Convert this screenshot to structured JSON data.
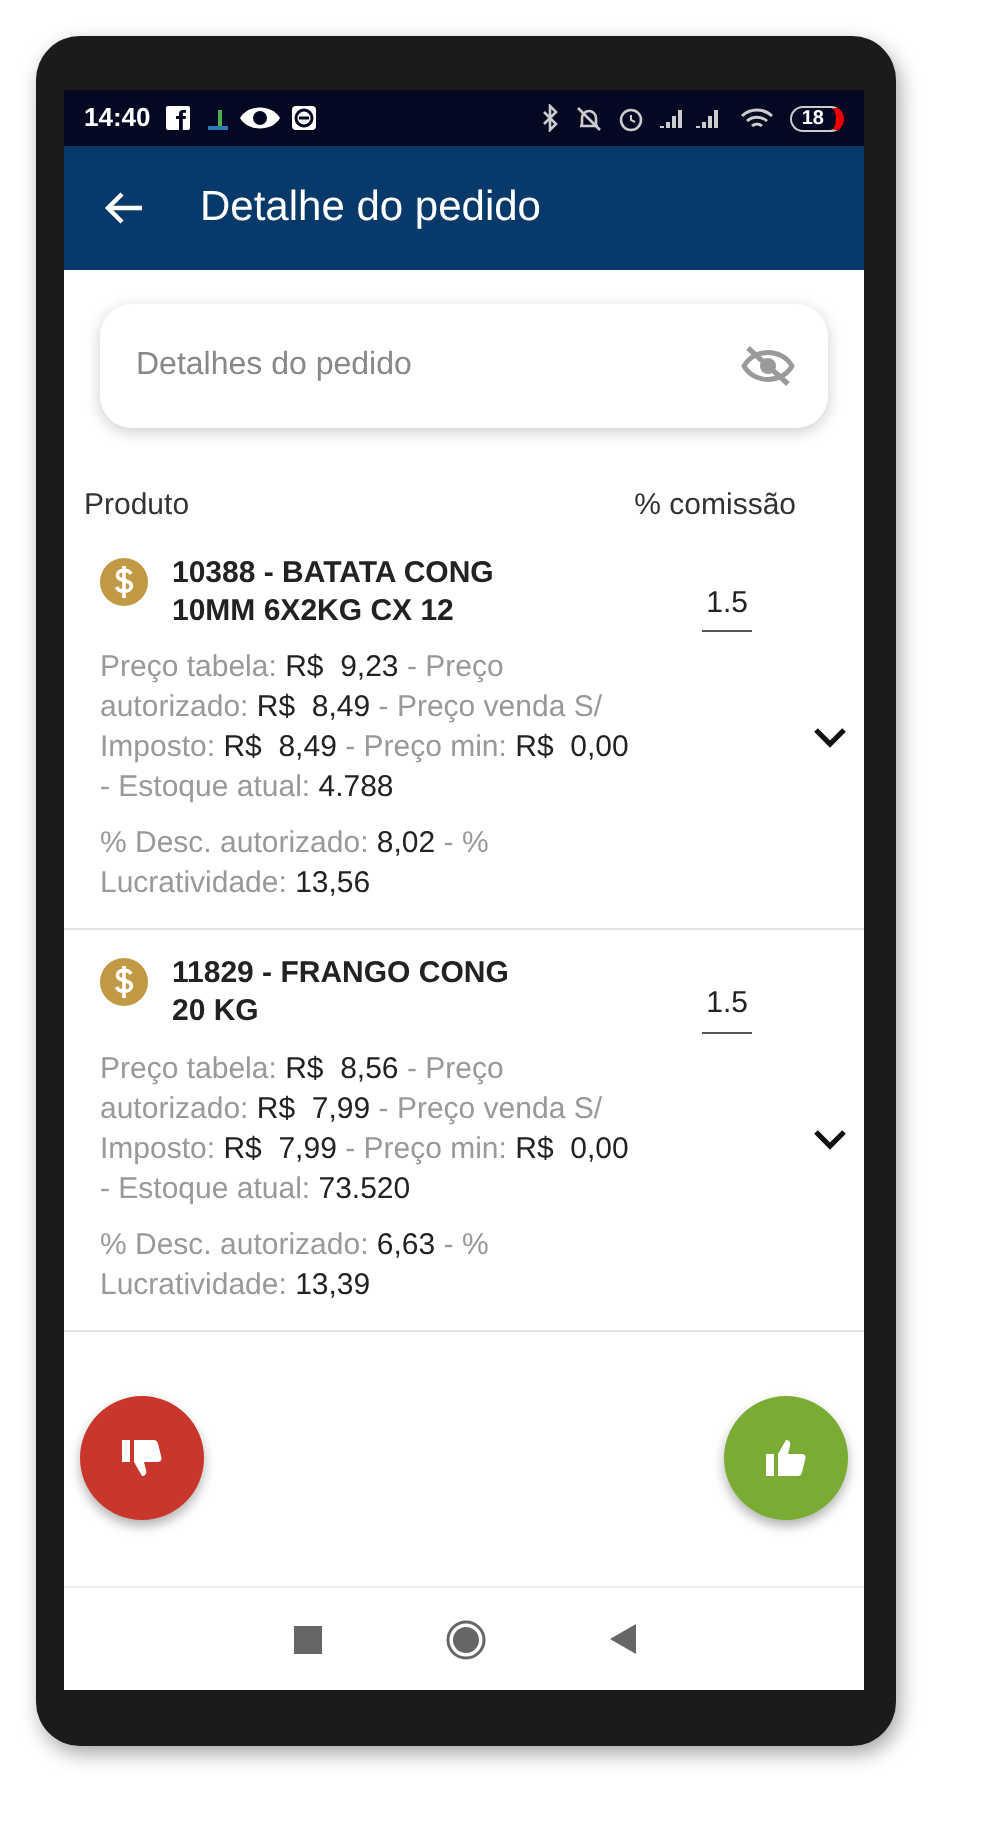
{
  "status_bar": {
    "time": "14:40",
    "battery": "18"
  },
  "app_bar": {
    "title": "Detalhe do pedido"
  },
  "search": {
    "placeholder": "Detalhes do pedido"
  },
  "columns": [
    "Produto",
    "% comissão"
  ],
  "products": [
    {
      "name_lines": [
        "10388 - BATATA CONG",
        "10MM 6X2KG CX 12"
      ],
      "commission": "1.5",
      "expanded": false,
      "details": "Preço tabela: **R$  9,23** - Preço autorizado: **R$  8,49** - Preço venda S/ Imposto: **R$  8,49** - Preço min: **R$  0,00** - Estoque atual: **4.788**",
      "margins": "% Desc. autorizado: **8,02** - % Lucratividade: **13,56**"
    },
    {
      "name_lines": [
        "11829 - FRANGO CONG",
        "20 KG"
      ],
      "commission": "1.5",
      "expanded": false,
      "details": "Preço tabela: **R$  8,56** - Preço autorizado: **R$  7,99** - Preço venda S/ Imposto: **R$  7,99** - Preço min: **R$  0,00** - Estoque atual: **73.520**",
      "margins": "% Desc. autorizado: **6,63** - % Lucratividade: **13,39**"
    }
  ],
  "actions": [
    {
      "kind": "reject"
    },
    {
      "kind": "approve"
    }
  ]
}
